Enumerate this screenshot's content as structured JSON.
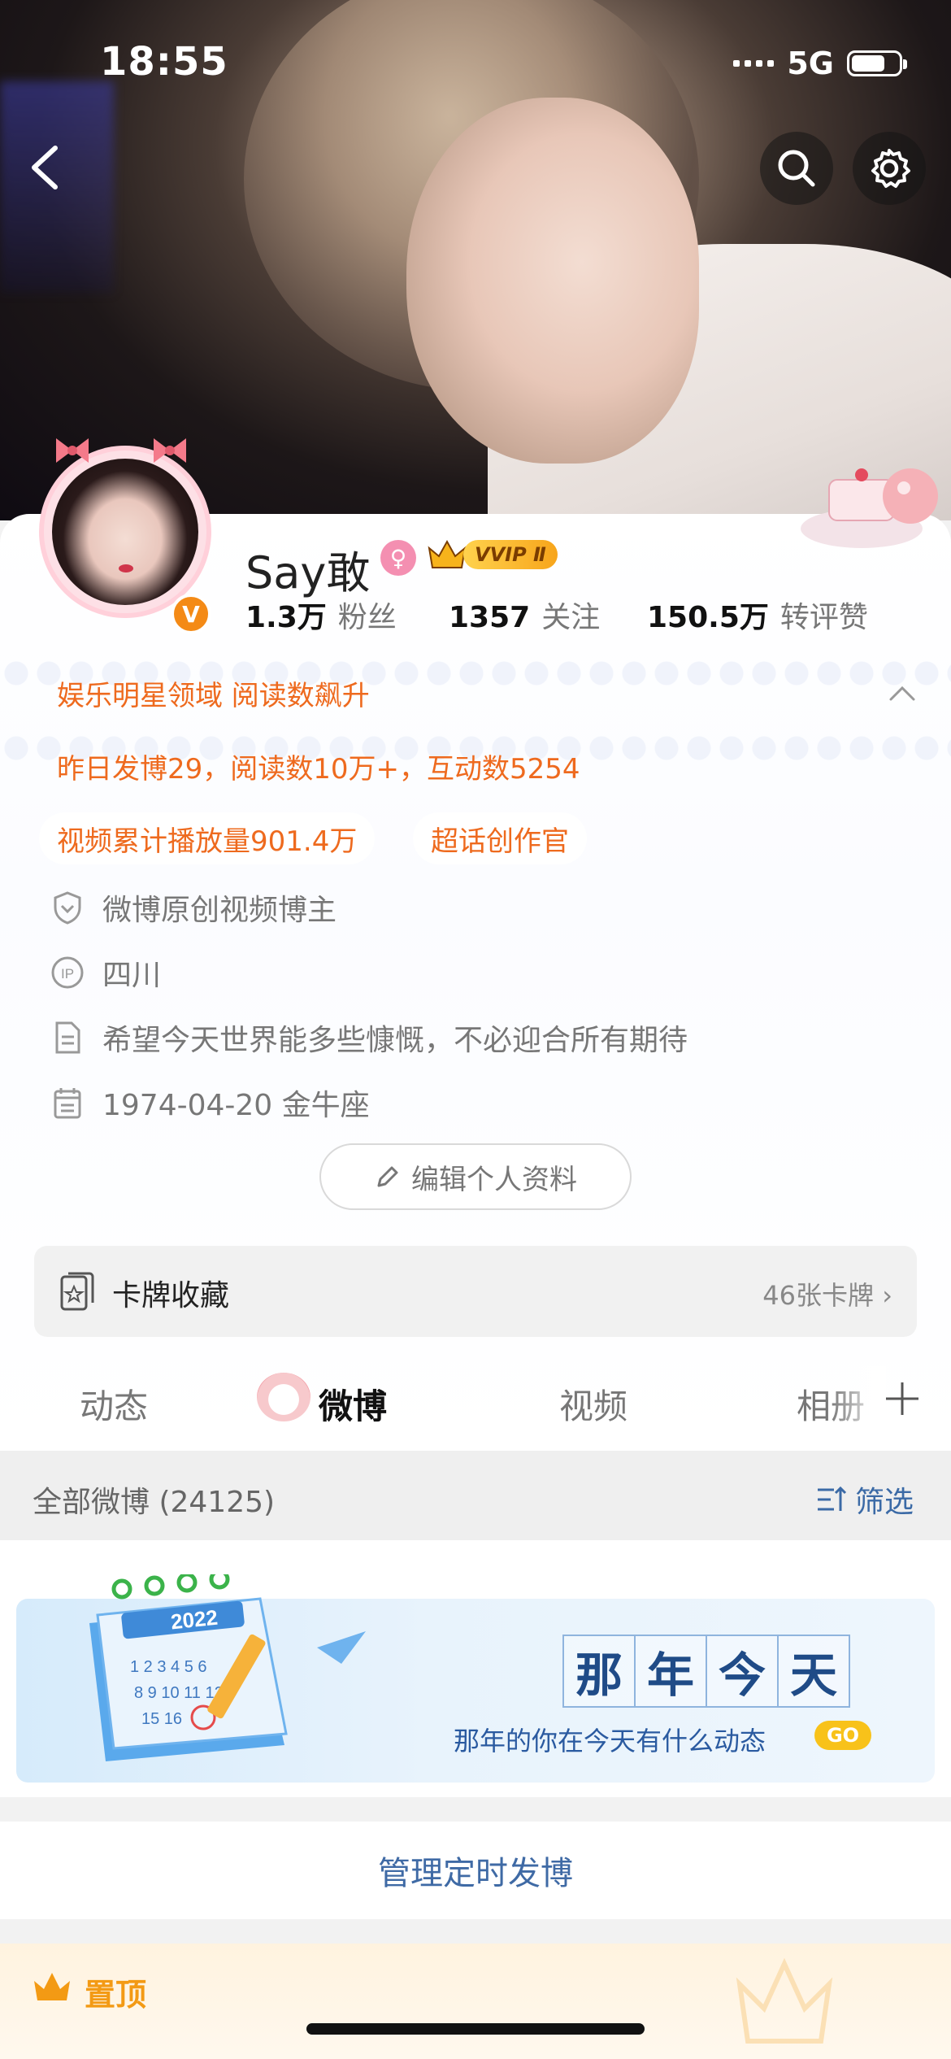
{
  "status_bar": {
    "time": "18:55",
    "network": "5G"
  },
  "profile": {
    "username": "Say敢",
    "vip_tag": "VVIP Ⅱ",
    "verified_letter": "V",
    "stats": [
      {
        "value": "1.3万",
        "label": "粉丝"
      },
      {
        "value": "1357",
        "label": "关注"
      },
      {
        "value": "150.5万",
        "label": "转评赞"
      }
    ],
    "hot_title": "娱乐明星领域 阅读数飙升",
    "hot_detail": "昨日发博29，阅读数10万+，互动数5254",
    "pills": [
      "视频累计播放量901.4万",
      "超话创作官"
    ],
    "info": [
      {
        "icon": "shield-icon",
        "text": "微博原创视频博主"
      },
      {
        "icon": "ip-icon",
        "text": "四川"
      },
      {
        "icon": "document-icon",
        "text": "希望今天世界能多些慷慨，不必迎合所有期待"
      },
      {
        "icon": "calendar-icon",
        "text": "1974-04-20 金牛座"
      }
    ],
    "edit_label": "编辑个人资料"
  },
  "card_collection": {
    "title": "卡牌收藏",
    "count": "46张卡牌"
  },
  "tabs": [
    "动态",
    "微博",
    "视频",
    "相册"
  ],
  "filter_bar": {
    "label": "全部微博 (24125)",
    "filter": "筛选"
  },
  "banner": {
    "title_chars": [
      "那",
      "年",
      "今",
      "天"
    ],
    "subtitle": "那年的你在今天有什么动态",
    "go": "GO",
    "calendar_year": "2022"
  },
  "manage_label": "管理定时发博",
  "pinned_label": "置顶",
  "colors": {
    "accent_orange": "#ee6a1e",
    "link_blue": "#3f6aa5",
    "pin_gold": "#f39a14"
  }
}
